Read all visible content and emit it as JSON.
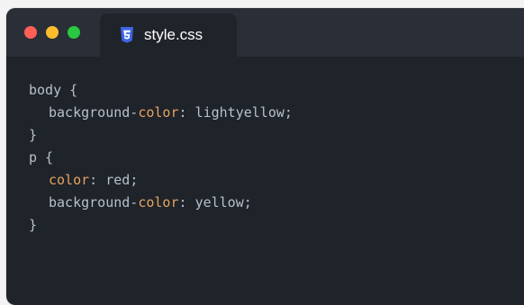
{
  "window": {
    "buttons": {
      "close_color": "#ff5f57",
      "minimize_color": "#febc2e",
      "zoom_color": "#28c840"
    },
    "tab": {
      "label": "style.css",
      "icon": "css3-icon",
      "icon_color": "#3d66e6"
    }
  },
  "editor": {
    "lines": [
      {
        "selector": "body",
        "brace": " {"
      },
      {
        "prop_pre": "background-",
        "prop_hl": "color",
        "colon": ": ",
        "value": "lightyellow",
        "semicolon": ";"
      },
      {
        "brace": "}"
      },
      {
        "selector": "p",
        "brace": " {"
      },
      {
        "prop_pre": "",
        "prop_hl": "color",
        "colon": ": ",
        "value": "red",
        "semicolon": ";"
      },
      {
        "prop_pre": "background-",
        "prop_hl": "color",
        "colon": ": ",
        "value": "yellow",
        "semicolon": ";"
      },
      {
        "brace": "}"
      }
    ],
    "colors": {
      "text": "#b9c0cb",
      "highlight": "#e6a35f",
      "background": "#1f232a"
    }
  }
}
